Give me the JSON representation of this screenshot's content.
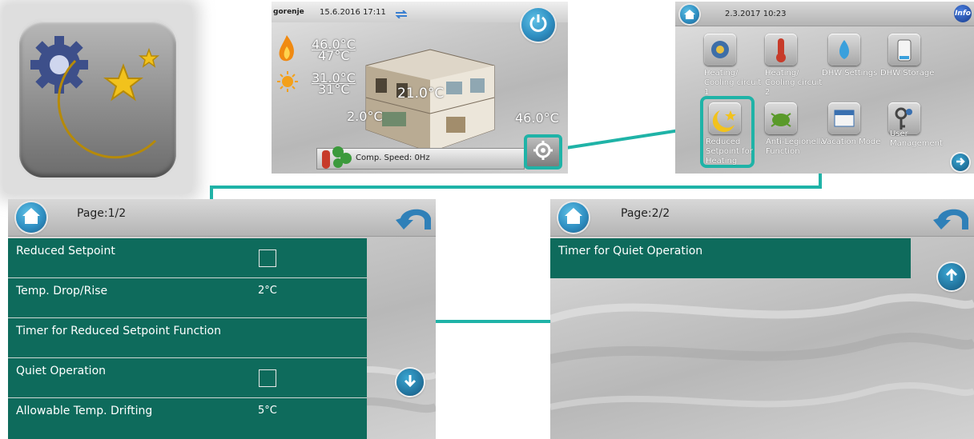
{
  "colors": {
    "teal": "#0e6b5c",
    "connector": "#1fb3a7",
    "button_blue": "#2f8fc2"
  },
  "house_screen": {
    "brand": "gorenje",
    "datetime": "15.6.2016 17:11",
    "dhw_temp_set": "46.0°C",
    "dhw_temp_actual": "47°C",
    "outdoor_temp_set": "31.0°C",
    "outdoor_temp_actual": "31°C",
    "left_temp": "2.0°C",
    "room_temp": "21.0°C",
    "right_temp": "46.0°C",
    "comp_speed": "Comp. Speed: 0Hz",
    "icons": {
      "power": "power-icon",
      "settings": "gear-icon",
      "flame": "flame-icon",
      "sun": "sun-icon"
    }
  },
  "menu_screen": {
    "datetime": "2.3.2017 10:23",
    "info_label": "Info",
    "items": [
      {
        "label": "Heating/\nCooling circuit\n1",
        "icon": "heating-circuit-1-icon"
      },
      {
        "label": "Heating/\nCooling circuit\n2",
        "icon": "heating-circuit-2-icon"
      },
      {
        "label": "DHW Settings",
        "icon": "dhw-settings-icon"
      },
      {
        "label": "DHW Storage",
        "icon": "dhw-storage-icon"
      },
      {
        "label": "Reduced\nSetpoint for\nHeating",
        "icon": "reduced-setpoint-icon"
      },
      {
        "label": "Anti-Legionella\nFunction",
        "icon": "anti-legionella-icon"
      },
      {
        "label": "Vacation Mode",
        "icon": "vacation-mode-icon"
      },
      {
        "label": "User\nManagement",
        "icon": "user-management-icon"
      }
    ]
  },
  "page1": {
    "page_label": "Page:1/2",
    "rows": [
      {
        "label": "Reduced Setpoint",
        "value": "",
        "checkbox": true
      },
      {
        "label": "Temp. Drop/Rise",
        "value": "2°C",
        "checkbox": false
      },
      {
        "label": "Timer for Reduced Setpoint Function",
        "value": "",
        "checkbox": false
      },
      {
        "label": "Quiet Operation",
        "value": "",
        "checkbox": true
      },
      {
        "label": "Allowable Temp. Drifting",
        "value": "5°C",
        "checkbox": false
      }
    ]
  },
  "page2": {
    "page_label": "Page:2/2",
    "rows": [
      {
        "label": "Timer for Quiet Operation"
      }
    ]
  }
}
